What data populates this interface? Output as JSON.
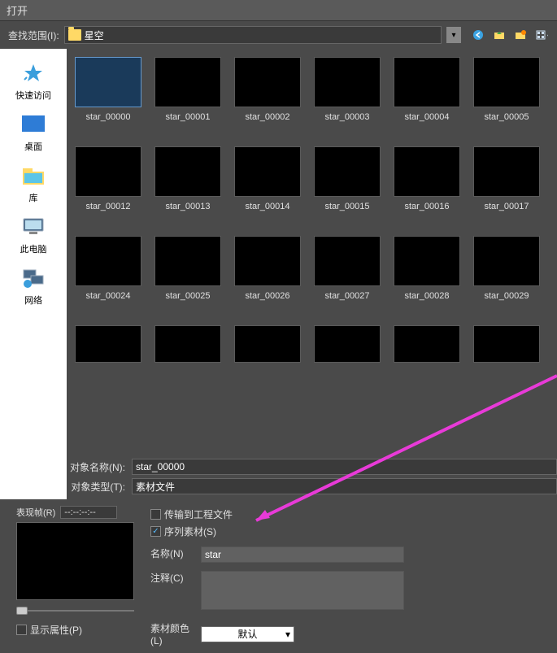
{
  "window": {
    "title": "打开",
    "lookup_label": "查找范围(I):",
    "current_folder": "星空"
  },
  "sidebar": {
    "items": [
      {
        "label": "快速访问",
        "icon": "star"
      },
      {
        "label": "桌面",
        "icon": "desktop"
      },
      {
        "label": "库",
        "icon": "library"
      },
      {
        "label": "此电脑",
        "icon": "computer"
      },
      {
        "label": "网络",
        "icon": "network"
      }
    ]
  },
  "files": {
    "row1": [
      "star_00000",
      "star_00001",
      "star_00002",
      "star_00003",
      "star_00004",
      "star_00005"
    ],
    "row2": [
      "star_00012",
      "star_00013",
      "star_00014",
      "star_00015",
      "star_00016",
      "star_00017"
    ],
    "row3": [
      "star_00024",
      "star_00025",
      "star_00026",
      "star_00027",
      "star_00028",
      "star_00029"
    ],
    "row4": [
      "",
      "",
      "",
      "",
      "",
      ""
    ]
  },
  "form": {
    "name_label": "对象名称(N):",
    "name_value": "star_00000",
    "type_label": "对象类型(T):",
    "type_value": "素材文件"
  },
  "preview": {
    "frame_label": "表现帧(R)",
    "time_value": "--:--:--:--",
    "show_attr_label": "显示属性(P)"
  },
  "options": {
    "transfer_label": "传输到工程文件",
    "sequence_label": "序列素材(S)",
    "name_label": "名称(N)",
    "name_value": "star",
    "comment_label": "注释(C)",
    "color_label": "素材颜色(L)",
    "color_value": "默认"
  }
}
